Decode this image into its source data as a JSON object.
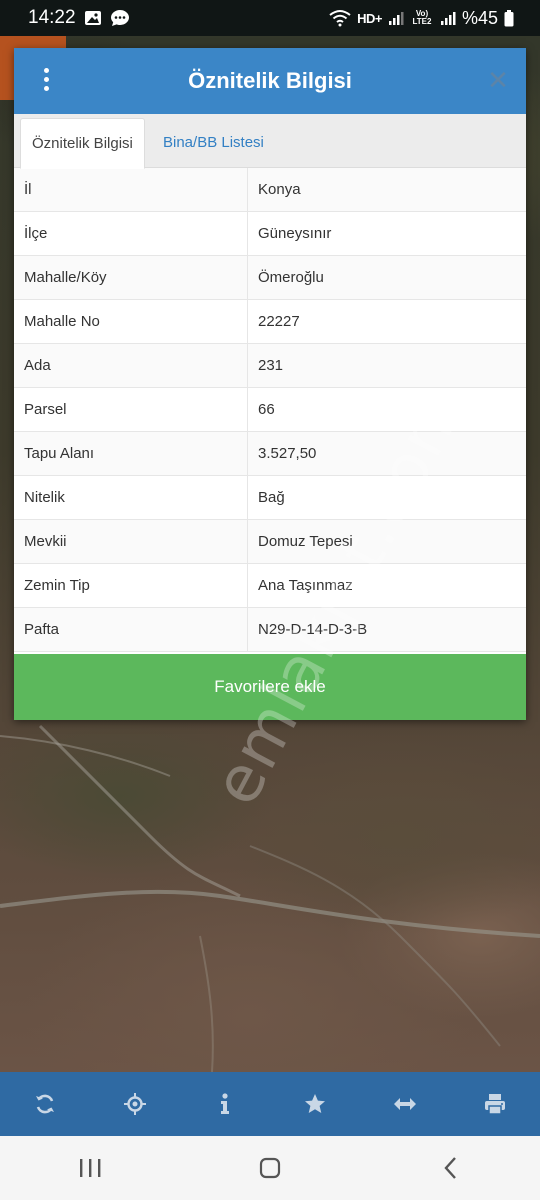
{
  "status_bar": {
    "time": "14:22",
    "network_hd": "HD+",
    "network_volte": "Vo) LTE2",
    "battery": "%45",
    "icons": [
      "gallery-icon",
      "chat-icon",
      "wifi-icon",
      "signal-icon",
      "battery-icon"
    ]
  },
  "dialog": {
    "title": "Öznitelik Bilgisi",
    "menu_icon": "kebab-menu-icon",
    "close_icon": "close-icon",
    "tabs": [
      {
        "label": "Öznitelik Bilgisi",
        "active": true
      },
      {
        "label": "Bina/BB Listesi",
        "active": false
      }
    ],
    "rows": [
      {
        "key": "İl",
        "value": "Konya"
      },
      {
        "key": "İlçe",
        "value": "Güneysınır"
      },
      {
        "key": "Mahalle/Köy",
        "value": "Ömeroğlu"
      },
      {
        "key": "Mahalle No",
        "value": "22227"
      },
      {
        "key": "Ada",
        "value": "231"
      },
      {
        "key": "Parsel",
        "value": "66"
      },
      {
        "key": "Tapu Alanı",
        "value": "3.527,50"
      },
      {
        "key": "Nitelik",
        "value": "Bağ"
      },
      {
        "key": "Mevkii",
        "value": "Domuz Tepesi"
      },
      {
        "key": "Zemin Tip",
        "value": "Ana Taşınmaz"
      },
      {
        "key": "Pafta",
        "value": "N29-D-14-D-3-B"
      }
    ],
    "favorite_button": "Favorilere ekle"
  },
  "watermark": "emlakjet.com",
  "toolbar": {
    "items": [
      "refresh-icon",
      "locate-icon",
      "info-icon",
      "star-icon",
      "measure-icon",
      "print-icon"
    ]
  },
  "navbar": {
    "items": [
      "recent-apps-icon",
      "home-icon",
      "back-icon"
    ]
  },
  "colors": {
    "header": "#3b86c7",
    "favorite": "#5cb85c",
    "toolbar": "#2f6aa3",
    "tab_link": "#3380c4"
  }
}
